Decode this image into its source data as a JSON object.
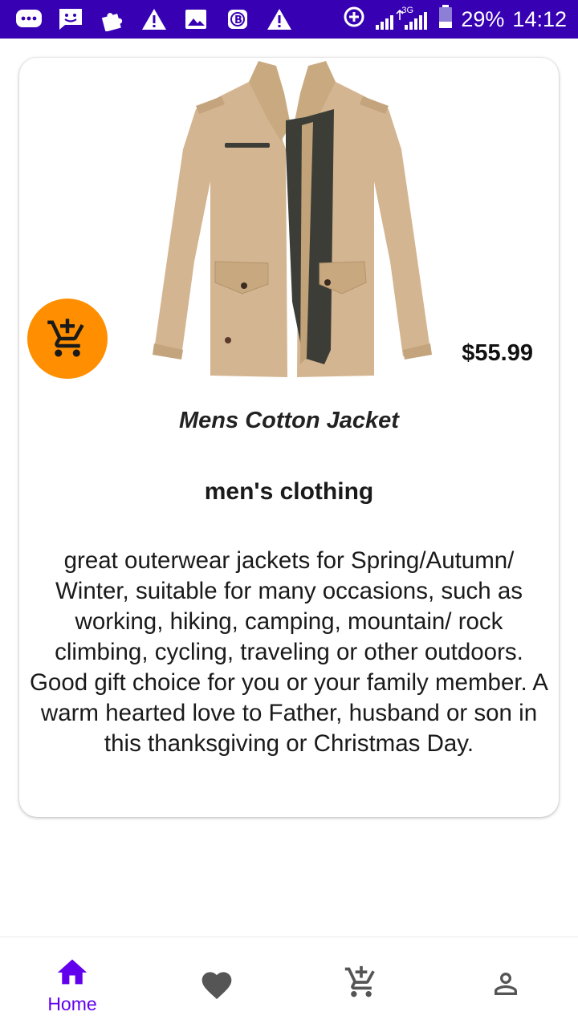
{
  "status_bar": {
    "battery": "29%",
    "time": "14:12",
    "network": "3G",
    "icons": [
      "messages-icon",
      "sms-icon",
      "puzzle-icon",
      "warning-icon",
      "gallery-icon",
      "b-app-icon",
      "warning-icon",
      "data-saver-icon",
      "signal-icon",
      "battery-icon"
    ]
  },
  "product": {
    "price": "$55.99",
    "title": "Mens Cotton Jacket",
    "category": "men's clothing",
    "description": "great outerwear jackets for Spring/Autumn/ Winter, suitable for many occasions, such as working, hiking, camping, mountain/ rock climbing, cycling, traveling or other outdoors. Good gift choice for you or your family member. A warm hearted love to Father, husband or son in this thanksgiving or Christmas Day.",
    "add_to_cart_icon": "add-shopping-cart-icon",
    "image": "khaki-jacket"
  },
  "colors": {
    "status_bar": "#3700b3",
    "accent": "#6200ee",
    "fab": "#ff8f00",
    "inactive_icon": "#555555"
  },
  "bottom_nav": {
    "items": [
      {
        "label": "Home",
        "icon": "home-icon",
        "active": true
      },
      {
        "label": "",
        "icon": "heart-icon",
        "active": false
      },
      {
        "label": "",
        "icon": "add-cart-icon",
        "active": false
      },
      {
        "label": "",
        "icon": "person-icon",
        "active": false
      }
    ]
  }
}
